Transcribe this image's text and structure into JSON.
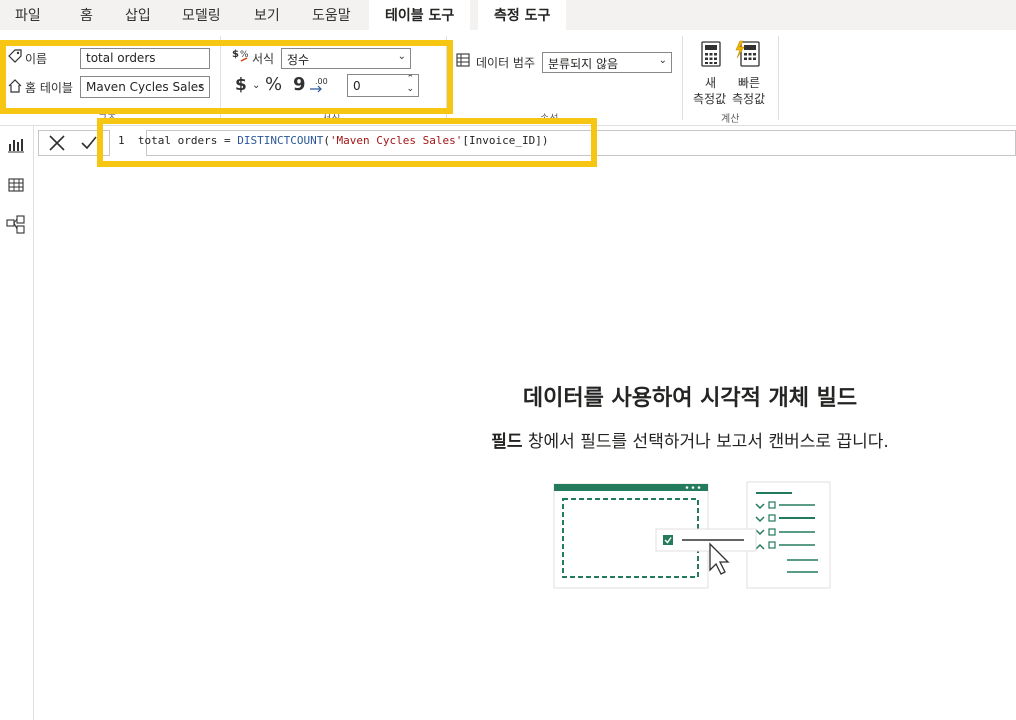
{
  "menu": {
    "items": [
      "파일",
      "홈",
      "삽입",
      "모델링",
      "보기",
      "도움말"
    ],
    "table_tools": "테이블 도구",
    "measure_tools": "측정 도구"
  },
  "ribbon": {
    "structure": {
      "name_label": "이름",
      "name_value": "total orders",
      "home_table_label": "홈 테이블",
      "home_table_value": "Maven Cycles Sales",
      "group_label": "구조"
    },
    "formatting": {
      "format_label": "서식",
      "format_value": "정수",
      "decimal_value": "0",
      "currency_symbol": "$",
      "percent_symbol": "%",
      "comma_symbol": "9",
      "group_label": "서식"
    },
    "properties": {
      "data_category_label": "데이터 범주",
      "data_category_value": "분류되지 않음",
      "group_label": "속성"
    },
    "calculations": {
      "new_measure_line1": "새",
      "new_measure_line2": "측정값",
      "quick_measure_line1": "빠른",
      "quick_measure_line2": "측정값",
      "group_label": "계산"
    }
  },
  "formula": {
    "line_number": "1",
    "measure_name": "total orders = ",
    "function": "DISTINCTCOUNT",
    "open_paren": "(",
    "table_ref": "'Maven Cycles Sales'",
    "column_ref": "[Invoice_ID])"
  },
  "canvas": {
    "empty_title": "데이터를 사용하여 시각적 개체 빌드",
    "empty_sub_bold": "필드",
    "empty_sub_rest": " 창에서 필드를 선택하거나 보고서 캔버스로 끕니다."
  },
  "colors": {
    "accent": "#f7c613",
    "green": "#237b5b",
    "ribbon_bg": "#f3f2f1"
  }
}
